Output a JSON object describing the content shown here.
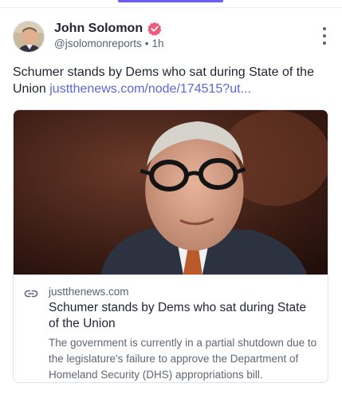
{
  "post": {
    "author": {
      "display_name": "John Solomon",
      "handle": "@jsolomonreports",
      "separator": "•",
      "timestamp": "1h",
      "verified": true
    },
    "text": "Schumer stands by Dems who sat during State of the Union ",
    "link_text": "justthenews.com/node/174515?ut..."
  },
  "card": {
    "domain": "justthenews.com",
    "title": "Schumer stands by Dems who sat during State of the Union",
    "description": "The government is currently in a partial shutdown due to the legislature's failure to approve the Department of Homeland Security (DHS) appropriations bill."
  },
  "colors": {
    "accent": "#6b5cff",
    "verified": "#ec5a7d",
    "link": "#5a67d8"
  },
  "icons": {
    "verified": "verified-badge-icon",
    "more": "more-vertical-icon",
    "link": "link-icon"
  }
}
